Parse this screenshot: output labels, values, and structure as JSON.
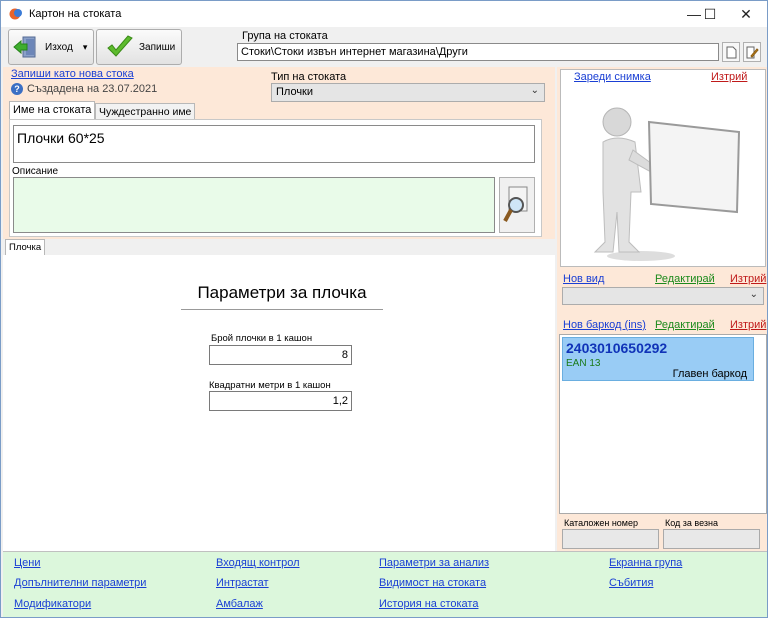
{
  "window": {
    "title": "Картон на стоката",
    "minimize": "—",
    "maximize": "☐",
    "close": "✕"
  },
  "toolbar": {
    "exit_label": "Изход",
    "save_label": "Запиши"
  },
  "group": {
    "label": "Група на стоката",
    "value": "Стоки\\Стоки извън интернет магазина\\Други"
  },
  "product": {
    "save_as_new": "Запиши като нова стока",
    "created": "Създадена на 23.07.2021",
    "type_label": "Тип на стоката",
    "type_value": "Плочки",
    "tabs": [
      "Име на стоката",
      "Чуждестранно име"
    ],
    "name_value": "Плочки 60*25",
    "description_label": "Описание",
    "description_value": ""
  },
  "tile_tab": {
    "label": "Плочка"
  },
  "params": {
    "title": "Параметри за плочка",
    "tiles_per_box_label": "Брой плочки в 1 кашон",
    "tiles_per_box_value": "8",
    "sqm_per_box_label": "Квадратни метри в 1 кашон",
    "sqm_per_box_value": "1,2"
  },
  "right": {
    "load_photo": "Зареди снимка",
    "delete_photo": "Изтрий",
    "new_kind": "Нов вид",
    "edit_kind": "Редактирай",
    "delete_kind": "Изтрий",
    "new_barcode": "Нов баркод (ins)",
    "edit_barcode": "Редактирай",
    "delete_barcode": "Изтрий",
    "barcode": {
      "code": "2403010650292",
      "type": "EAN 13",
      "role": "Главен баркод"
    },
    "catalog_label": "Каталожен номер",
    "scale_code_label": "Код за везна"
  },
  "bottom_links": {
    "col1": [
      "Цени",
      "Допълнителни параметри",
      "Модификатори"
    ],
    "col2": [
      "Входящ контрол",
      "Интрастат",
      "Амбалаж"
    ],
    "col3": [
      "Параметри за анализ",
      "Видимост на стоката",
      "История на стоката"
    ],
    "col4": [
      "Екранна група",
      "Събития"
    ]
  },
  "colors": {
    "peach_panel": "#fde8d8",
    "bottom_panel": "#dcf7dc",
    "barcode_highlight": "#99ccf5",
    "link_blue": "#1a3fd4",
    "link_green": "#1c8a1c",
    "link_red": "#c01a1a"
  }
}
